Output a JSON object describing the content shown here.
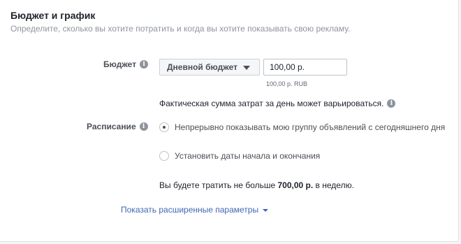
{
  "section": {
    "title": "Бюджет и график",
    "subtitle": "Определите, сколько вы хотите потратить и когда вы хотите показывать свою рекламу."
  },
  "budget": {
    "label": "Бюджет",
    "type_selected": "Дневной бюджет",
    "amount_value": "100,00 р.",
    "amount_hint": "100,00 р. RUB",
    "spend_note": "Фактическая сумма затрат за день может варьироваться."
  },
  "schedule": {
    "label": "Расписание",
    "options": [
      {
        "label": "Непрерывно показывать мою группу объявлений с сегодняшнего дня",
        "selected": true
      },
      {
        "label": "Установить даты начала и окончания",
        "selected": false
      }
    ]
  },
  "weekly": {
    "prefix": "Вы будете тратить не больше",
    "amount": "700,00 р.",
    "suffix": "в неделю."
  },
  "advanced_link": "Показать расширенные параметры",
  "icons": {
    "info": "info-icon",
    "dropdown": "caret-down-icon"
  },
  "colors": {
    "link": "#4267b2",
    "border": "#dddfe2",
    "text": "#1d2129"
  }
}
